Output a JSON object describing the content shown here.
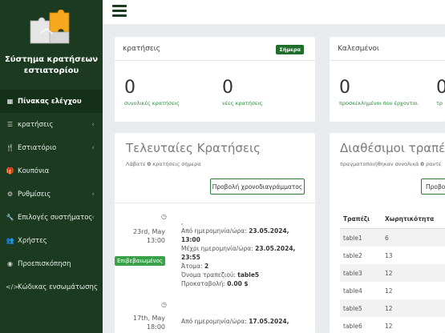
{
  "sidebar": {
    "brand": "Σύστημα κρατήσεων εστιατορίου",
    "items": [
      {
        "label": "Πίνακας ελέγχου",
        "icon": "dashboard-icon",
        "active": true,
        "chevron": false
      },
      {
        "label": "κρατήσεις",
        "icon": "list-icon",
        "active": false,
        "chevron": true
      },
      {
        "label": "Εστιατόριο",
        "icon": "utensils-icon",
        "active": false,
        "chevron": true
      },
      {
        "label": "Κουπόνια",
        "icon": "gift-icon",
        "active": false,
        "chevron": false
      },
      {
        "label": "Ρυθμίσεις",
        "icon": "gears-icon",
        "active": false,
        "chevron": true
      },
      {
        "label": "Επιλογές συστήματος",
        "icon": "wrench-icon",
        "active": false,
        "chevron": true
      },
      {
        "label": "Χρήστες",
        "icon": "users-icon",
        "active": false,
        "chevron": false
      },
      {
        "label": "Προεπισκόπηση",
        "icon": "eye-icon",
        "active": false,
        "chevron": false
      },
      {
        "label": "Κώδικας ενσωμάτωσης",
        "icon": "code-icon",
        "active": false,
        "chevron": false
      }
    ]
  },
  "reservations_card": {
    "title": "κρατήσεις",
    "badge": "Σήμερα",
    "total_value": "0",
    "total_label": "συνολικές κρατήσεις",
    "new_value": "0",
    "new_label": "νέες κρατήσεις"
  },
  "called_card": {
    "title": "Καλεσμένοι",
    "invited_value": "0",
    "invited_label": "προσκεκλημένοι που έρχονται",
    "second_value": "0",
    "second_label": "τρ"
  },
  "latest": {
    "title": "Τελευταίες Κρατήσεις",
    "subtitle_pre": "Λάβατε",
    "subtitle_count": "0",
    "subtitle_post": "κρατήσεις σήμερα",
    "button": "Προβολή χρονοδιαγράμματος",
    "entries": [
      {
        "date": "23rd, May",
        "time": "13:00",
        "status": "Επιβεβαιωμένος",
        "name": ",",
        "from_label": "Από ημερομηνία/ώρα:",
        "from_value": "23.05.2024,",
        "from_time": "13:00",
        "to_label": "Μέχρι ημερομηνία/ώρα:",
        "to_value": "23.05.2024,",
        "to_time": "23:55",
        "people_label": "Άτομα:",
        "people_value": "2",
        "table_label": "Όνομα τραπεζιού:",
        "table_value": "table5",
        "deposit_label": "Προκαταβολή:",
        "deposit_value": "0.00 $"
      },
      {
        "date": "17th, May",
        "time": "18:00",
        "from_label": "Από ημερομηνία/ώρα:",
        "from_value": "17.05.2024,"
      }
    ]
  },
  "tables_panel": {
    "title": "Διαθέσιμοι τραπέζια",
    "subtitle_pre": "πραγματοποιήθηκαν συνολικά",
    "subtitle_count": "0",
    "subtitle_post": "ραντε",
    "button": "Προβο",
    "col_table": "Τραπέζι",
    "col_capacity": "Χωρητικότητα",
    "rows": [
      {
        "name": "table1",
        "capacity": "6"
      },
      {
        "name": "table2",
        "capacity": "13"
      },
      {
        "name": "table3",
        "capacity": "12"
      },
      {
        "name": "table4",
        "capacity": "12"
      },
      {
        "name": "table5",
        "capacity": "12"
      },
      {
        "name": "table6",
        "capacity": "12"
      }
    ]
  },
  "colors": {
    "sidebar_bg": "#1b3a20",
    "accent": "#1f6e2c",
    "status_confirmed": "#3aa14b"
  }
}
